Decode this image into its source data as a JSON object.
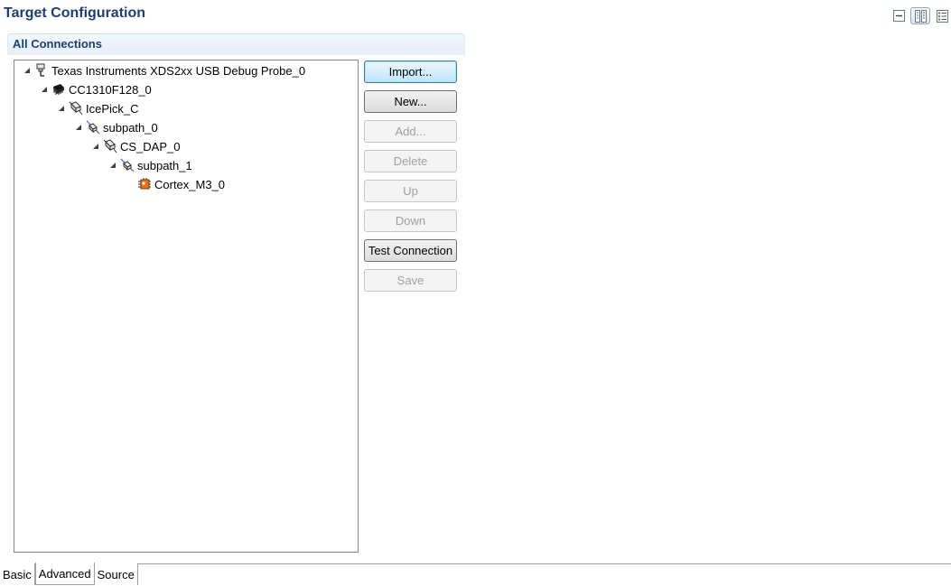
{
  "header": {
    "title": "Target Configuration"
  },
  "view_buttons": [
    {
      "icon": "collapse-all-icon"
    },
    {
      "icon": "horizontal-layout-icon",
      "active": true
    },
    {
      "icon": "vertical-layout-icon"
    }
  ],
  "section": {
    "title": "All Connections"
  },
  "tree": {
    "nodes": [
      {
        "label": "Texas Instruments XDS2xx USB Debug Probe_0",
        "icon": "probe-icon",
        "expanded": true
      },
      {
        "label": "CC1310F128_0",
        "icon": "chip-icon",
        "expanded": true
      },
      {
        "label": "IcePick_C",
        "icon": "router-icon",
        "expanded": true
      },
      {
        "label": "subpath_0",
        "icon": "subpath-icon",
        "expanded": true
      },
      {
        "label": "CS_DAP_0",
        "icon": "router-icon",
        "expanded": true
      },
      {
        "label": "subpath_1",
        "icon": "subpath-icon",
        "expanded": true
      },
      {
        "label": "Cortex_M3_0",
        "icon": "cpu-core-icon",
        "expanded": false
      }
    ]
  },
  "buttons": {
    "import": "Import...",
    "new": "New...",
    "add": "Add...",
    "delete": "Delete",
    "up": "Up",
    "down": "Down",
    "test_connection": "Test Connection",
    "save": "Save"
  },
  "tabs": [
    {
      "label": "Basic",
      "active": false
    },
    {
      "label": "Advanced",
      "active": true
    },
    {
      "label": "Source",
      "active": false
    }
  ],
  "colors": {
    "title": "#1f3f6e",
    "default_button_border": "#3c7fb1"
  }
}
